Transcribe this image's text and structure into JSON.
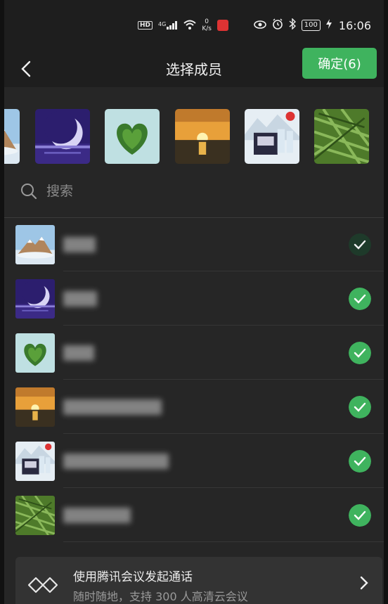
{
  "status_bar": {
    "hd": "HD",
    "signal_label": "4G",
    "net_speed_value": "0",
    "net_speed_unit": "K/s",
    "battery": "100",
    "time": "16:06"
  },
  "header": {
    "title": "选择成员",
    "confirm_label": "确定(6)"
  },
  "selected_strip": {
    "items": [
      {
        "avatar": "mountain-photo"
      },
      {
        "avatar": "moon-photo"
      },
      {
        "avatar": "heart-island-photo"
      },
      {
        "avatar": "sunset-photo"
      },
      {
        "avatar": "water-box-photo"
      },
      {
        "avatar": "grass-photo"
      }
    ]
  },
  "search": {
    "placeholder": "搜索"
  },
  "members": [
    {
      "avatar": "mountain-photo",
      "checked": true,
      "check_style": "dim"
    },
    {
      "avatar": "moon-photo",
      "checked": true,
      "check_style": "green"
    },
    {
      "avatar": "heart-island-photo",
      "checked": true,
      "check_style": "green"
    },
    {
      "avatar": "sunset-photo",
      "checked": true,
      "check_style": "green"
    },
    {
      "avatar": "water-box-photo",
      "checked": true,
      "check_style": "green"
    },
    {
      "avatar": "grass-photo",
      "checked": true,
      "check_style": "green"
    }
  ],
  "meeting_card": {
    "title": "使用腾讯会议发起通话",
    "subtitle": "随时随地，支持 300 人高清云会议"
  },
  "colors": {
    "accent_green": "#3fb35e",
    "background": "#262626",
    "header_bg": "#1e1e1e"
  }
}
